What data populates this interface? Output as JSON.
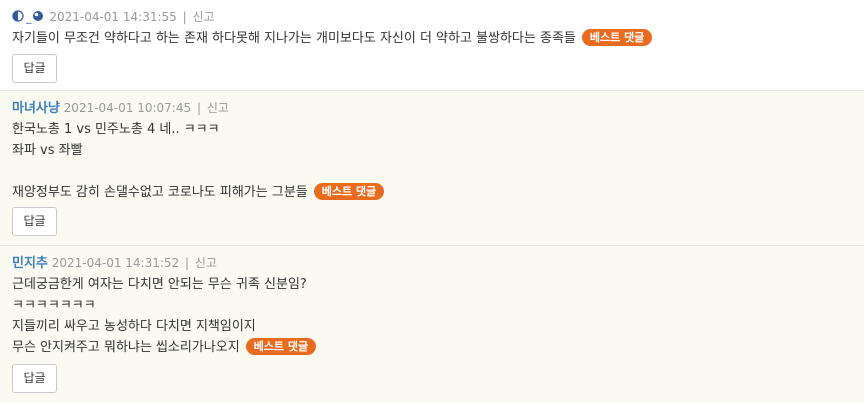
{
  "comments": [
    {
      "author": "",
      "author_icons": [
        "half-moon-icon",
        "eye-ball-icon"
      ],
      "timestamp": "2021-04-01 14:31:55",
      "separator": "|",
      "report_label": "신고",
      "lines": [
        "자기들이 무조건 약하다고 하는 존재 하다못해 지나가는 개미보다도 자신이 더 약하고 불쌍하다는 종족들"
      ],
      "badge": "베스트 댓글",
      "reply_label": "답글"
    },
    {
      "author": "마녀사냥",
      "timestamp": "2021-04-01 10:07:45",
      "separator": "|",
      "report_label": "신고",
      "lines": [
        "한국노총 1 vs 민주노총 4 네.. ㅋㅋㅋ",
        "좌파 vs 좌빨",
        "",
        "재앙정부도 감히 손댈수없고 코로나도 피해가는 그분들"
      ],
      "badge": "베스트 댓글",
      "reply_label": "답글"
    },
    {
      "author": "민지추",
      "timestamp": "2021-04-01 14:31:52",
      "separator": "|",
      "report_label": "신고",
      "lines": [
        "근데궁금한게 여자는 다치면 안되는 무슨 귀족 신분임?",
        "ㅋㅋㅋㅋㅋㅋㅋ",
        "지들끼리 싸우고 농성하다 다치면 지책임이지",
        "무슨 안지켜주고 뭐하냐는 씹소리가나오지"
      ],
      "badge": "베스트 댓글",
      "reply_label": "답글"
    }
  ],
  "colors": {
    "author": "#3a7fc1",
    "badge": "#e86b1f",
    "meta": "#999999",
    "background": "#fafaf0"
  }
}
